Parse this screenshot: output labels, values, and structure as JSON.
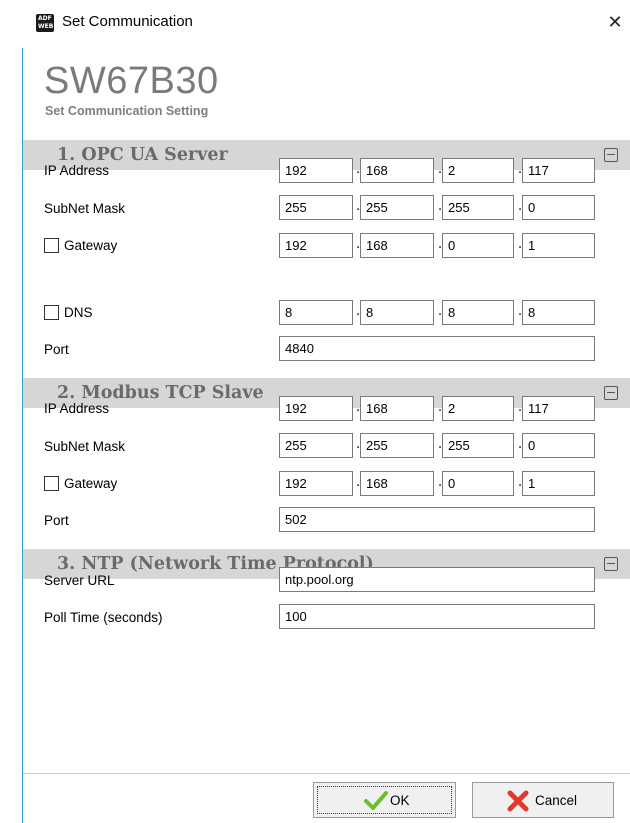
{
  "window": {
    "title": "Set Communication",
    "close_symbol": "✕",
    "app_icon": {
      "line1": "ADF",
      "line2": "WEB"
    }
  },
  "header": {
    "title": "SW67B30",
    "subtitle": "Set Communication Setting"
  },
  "sections": {
    "opc": {
      "title": "1. OPC UA Server",
      "ip_label": "IP Address",
      "ip": [
        "192",
        "168",
        "2",
        "117"
      ],
      "mask_label": "SubNet Mask",
      "mask": [
        "255",
        "255",
        "255",
        "0"
      ],
      "gateway_label": "Gateway",
      "gateway_checked": false,
      "gateway": [
        "192",
        "168",
        "0",
        "1"
      ],
      "dns_label": "DNS",
      "dns_checked": false,
      "dns": [
        "8",
        "8",
        "8",
        "8"
      ],
      "port_label": "Port",
      "port": "4840"
    },
    "modbus": {
      "title": "2. Modbus TCP Slave",
      "ip_label": "IP Address",
      "ip": [
        "192",
        "168",
        "2",
        "117"
      ],
      "mask_label": "SubNet Mask",
      "mask": [
        "255",
        "255",
        "255",
        "0"
      ],
      "gateway_label": "Gateway",
      "gateway_checked": false,
      "gateway": [
        "192",
        "168",
        "0",
        "1"
      ],
      "port_label": "Port",
      "port": "502"
    },
    "ntp": {
      "title": "3. NTP (Network Time Protocol)",
      "server_label": "Server URL",
      "server": "ntp.pool.org",
      "poll_label": "Poll Time (seconds)",
      "poll": "100"
    }
  },
  "buttons": {
    "ok_label": "OK",
    "cancel_label": "Cancel",
    "ok_icon": "checkmark-icon",
    "cancel_icon": "red-x-icon"
  },
  "colors": {
    "section_header_bg": "#d6d6d6",
    "section_header_text": "#6a6a6a",
    "header_title": "#7a7a7a",
    "window_accent": "#2aa4c4"
  }
}
